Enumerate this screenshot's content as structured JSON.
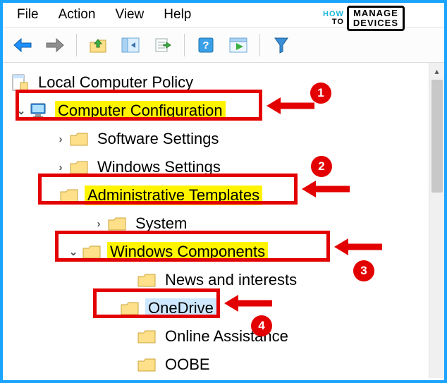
{
  "menu": {
    "file": "File",
    "action": "Action",
    "view": "View",
    "help": "Help"
  },
  "watermark": {
    "how": "HOW",
    "to": "TO",
    "manage": "MANAGE",
    "devices": "DEVICES"
  },
  "tree": {
    "root": "Local Computer Policy",
    "computer_config": "Computer Configuration",
    "software_settings": "Software Settings",
    "windows_settings": "Windows Settings",
    "admin_templates": "Administrative Templates",
    "system": "System",
    "windows_components": "Windows Components",
    "news_interests": "News and interests",
    "onedrive": "OneDrive",
    "online_assistance": "Online Assistance",
    "oobe": "OOBE"
  },
  "badges": {
    "b1": "1",
    "b2": "2",
    "b3": "3",
    "b4": "4"
  }
}
